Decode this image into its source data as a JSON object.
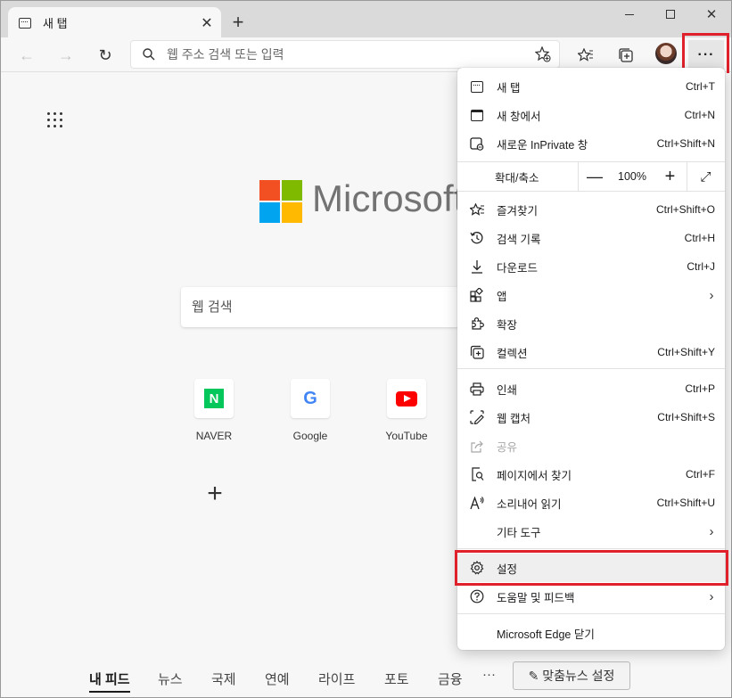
{
  "window": {
    "tab_title": "새 탭",
    "tab_close": "✕",
    "new_tab": "+",
    "controls": {
      "close": "✕"
    }
  },
  "toolbar": {
    "back": "←",
    "forward": "→",
    "refresh": "↻",
    "address_placeholder": "웹 주소 검색 또는 입력",
    "more": "···"
  },
  "ntp": {
    "wordmark": "Microsoft",
    "search_placeholder": "웹 검색",
    "tiles": [
      {
        "label": "NAVER",
        "mark": "N"
      },
      {
        "label": "Google",
        "mark": "G"
      },
      {
        "label": "YouTube"
      }
    ],
    "add_tile": "+",
    "feed": {
      "items": [
        "내 피드",
        "뉴스",
        "국제",
        "연예",
        "라이프",
        "포토",
        "금융"
      ],
      "more": "···",
      "settings": "✎ 맞춤뉴스 설정"
    }
  },
  "menu": {
    "items": [
      {
        "label": "새 탭",
        "shortcut": "Ctrl+T",
        "icon": "new-tab-icon"
      },
      {
        "label": "새 창에서",
        "shortcut": "Ctrl+N",
        "icon": "new-window-icon"
      },
      {
        "label": "새로운 InPrivate 창",
        "shortcut": "Ctrl+Shift+N",
        "icon": "inprivate-icon"
      },
      {
        "label": "즐겨찾기",
        "shortcut": "Ctrl+Shift+O",
        "icon": "favorites-icon"
      },
      {
        "label": "검색 기록",
        "shortcut": "Ctrl+H",
        "icon": "history-icon"
      },
      {
        "label": "다운로드",
        "shortcut": "Ctrl+J",
        "icon": "download-icon"
      },
      {
        "label": "앱",
        "shortcut": "",
        "icon": "apps-icon"
      },
      {
        "label": "확장",
        "shortcut": "",
        "icon": "extensions-icon"
      },
      {
        "label": "컬렉션",
        "shortcut": "Ctrl+Shift+Y",
        "icon": "collections-icon"
      },
      {
        "label": "인쇄",
        "shortcut": "Ctrl+P",
        "icon": "print-icon"
      },
      {
        "label": "웹 캡처",
        "shortcut": "Ctrl+Shift+S",
        "icon": "web-capture-icon"
      },
      {
        "label": "공유",
        "shortcut": "",
        "icon": "share-icon"
      },
      {
        "label": "페이지에서 찾기",
        "shortcut": "Ctrl+F",
        "icon": "find-icon"
      },
      {
        "label": "소리내어 읽기",
        "shortcut": "Ctrl+Shift+U",
        "icon": "read-aloud-icon"
      },
      {
        "label": "기타 도구",
        "shortcut": "",
        "icon": ""
      },
      {
        "label": "설정",
        "shortcut": "",
        "icon": "settings-icon"
      },
      {
        "label": "도움말 및 피드백",
        "shortcut": "",
        "icon": "help-icon"
      },
      {
        "label": "Microsoft Edge 닫기",
        "shortcut": "",
        "icon": ""
      }
    ],
    "zoom": {
      "label": "확대/축소",
      "minus": "—",
      "value": "100%",
      "plus": "+",
      "fullscreen": "⤢"
    },
    "chevron": "›"
  },
  "colors": {
    "highlight": "#e0202a",
    "menu_bg": "#ffffff",
    "titlebar": "#dadada"
  }
}
